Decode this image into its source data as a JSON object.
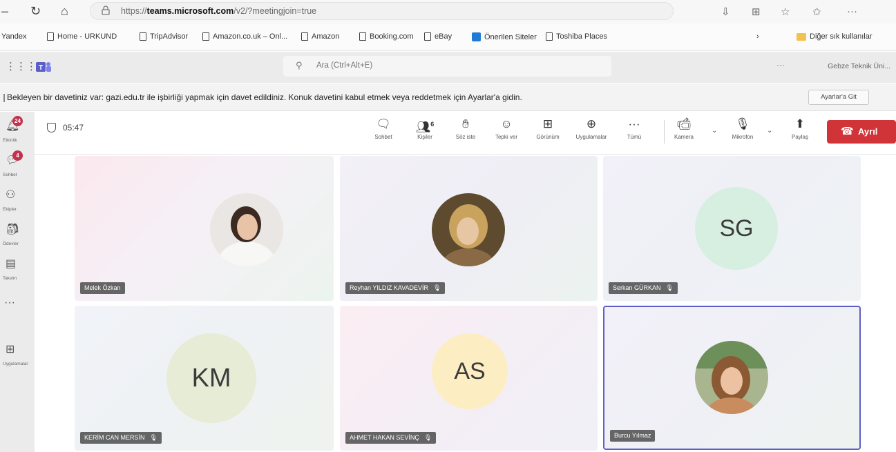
{
  "browser": {
    "url_prefix": "https://",
    "url_host": "teams.microsoft.com",
    "url_path": "/v2/?meetingjoin=true"
  },
  "bookmarks": [
    {
      "label": "Yandex",
      "icon": "none"
    },
    {
      "label": "Home - URKUND",
      "icon": "page"
    },
    {
      "label": "TripAdvisor",
      "icon": "page"
    },
    {
      "label": "Amazon.co.uk – Onl...",
      "icon": "page"
    },
    {
      "label": "Amazon",
      "icon": "page"
    },
    {
      "label": "Booking.com",
      "icon": "page"
    },
    {
      "label": "eBay",
      "icon": "page"
    },
    {
      "label": "Önerilen Siteler",
      "icon": "blue"
    },
    {
      "label": "Toshiba Places",
      "icon": "page"
    },
    {
      "label": "Diğer sık kullanılar",
      "icon": "folder"
    }
  ],
  "teams_header": {
    "search_placeholder": "Ara (Ctrl+Alt+E)",
    "org_name": "Gebze Teknik Üni..."
  },
  "notification": {
    "text": "Bekleyen bir davetiniz var: gazi.edu.tr ile işbirliği yapmak için davet edildiniz. Konuk davetini kabul etmek veya reddetmek için Ayarlar'a gidin.",
    "button": "Ayarlar'a Git"
  },
  "rail": [
    {
      "label": "Etkinlik",
      "badge": "24",
      "icon": "bell-icon"
    },
    {
      "label": "Sohbet",
      "badge": "4",
      "icon": "chat-icon"
    },
    {
      "label": "Ekipler",
      "badge": "",
      "icon": "teams-icon"
    },
    {
      "label": "Ödevler",
      "badge": "",
      "icon": "assignments-icon"
    },
    {
      "label": "Takvim",
      "badge": "",
      "icon": "calendar-icon"
    },
    {
      "label": "",
      "badge": "",
      "icon": "more-icon"
    },
    {
      "label": "Uygulamalar",
      "badge": "",
      "icon": "apps-icon"
    }
  ],
  "meeting": {
    "timer": "05:47",
    "tools": [
      {
        "label": "Sohbet",
        "icon": "chat-icon",
        "glyph": "💬"
      },
      {
        "label": "Kişiler",
        "icon": "people-icon",
        "glyph": "👥",
        "count": "6"
      },
      {
        "label": "Söz iste",
        "icon": "raise-hand-icon",
        "glyph": "✋"
      },
      {
        "label": "Tepki ver",
        "icon": "emoji-icon",
        "glyph": "☺"
      },
      {
        "label": "Görünüm",
        "icon": "view-icon",
        "glyph": "⊞"
      },
      {
        "label": "Uygulamalar",
        "icon": "apps-icon",
        "glyph": "⊞"
      },
      {
        "label": "Tümü",
        "icon": "more-icon",
        "glyph": "···"
      },
      {
        "label": "Kamera",
        "icon": "camera-off-icon",
        "glyph": "📹"
      },
      {
        "label": "Mikrofon",
        "icon": "mic-icon",
        "glyph": "🎤"
      },
      {
        "label": "Paylaş",
        "icon": "share-icon",
        "glyph": "⬆"
      }
    ],
    "leave": "Ayrıl"
  },
  "participants": [
    {
      "name": "Melek Özkan",
      "kind": "photo",
      "mic": false,
      "initials": ""
    },
    {
      "name": "Reyhan YILDIZ KAVADEVİR",
      "kind": "photo",
      "mic": true,
      "initials": ""
    },
    {
      "name": "Serkan GÜRKAN",
      "kind": "initials",
      "mic": true,
      "initials": "SG",
      "color": "#d6efe0"
    },
    {
      "name": "KERİM CAN MERSİN",
      "kind": "initials",
      "mic": true,
      "initials": "KM",
      "color": "#e6ecd6"
    },
    {
      "name": "AHMET HAKAN SEVİNÇ",
      "kind": "initials",
      "mic": true,
      "initials": "AS",
      "color": "#fdedc3"
    },
    {
      "name": "Burcu Yılmaz",
      "kind": "photo",
      "mic": false,
      "initials": "",
      "active": true
    }
  ]
}
